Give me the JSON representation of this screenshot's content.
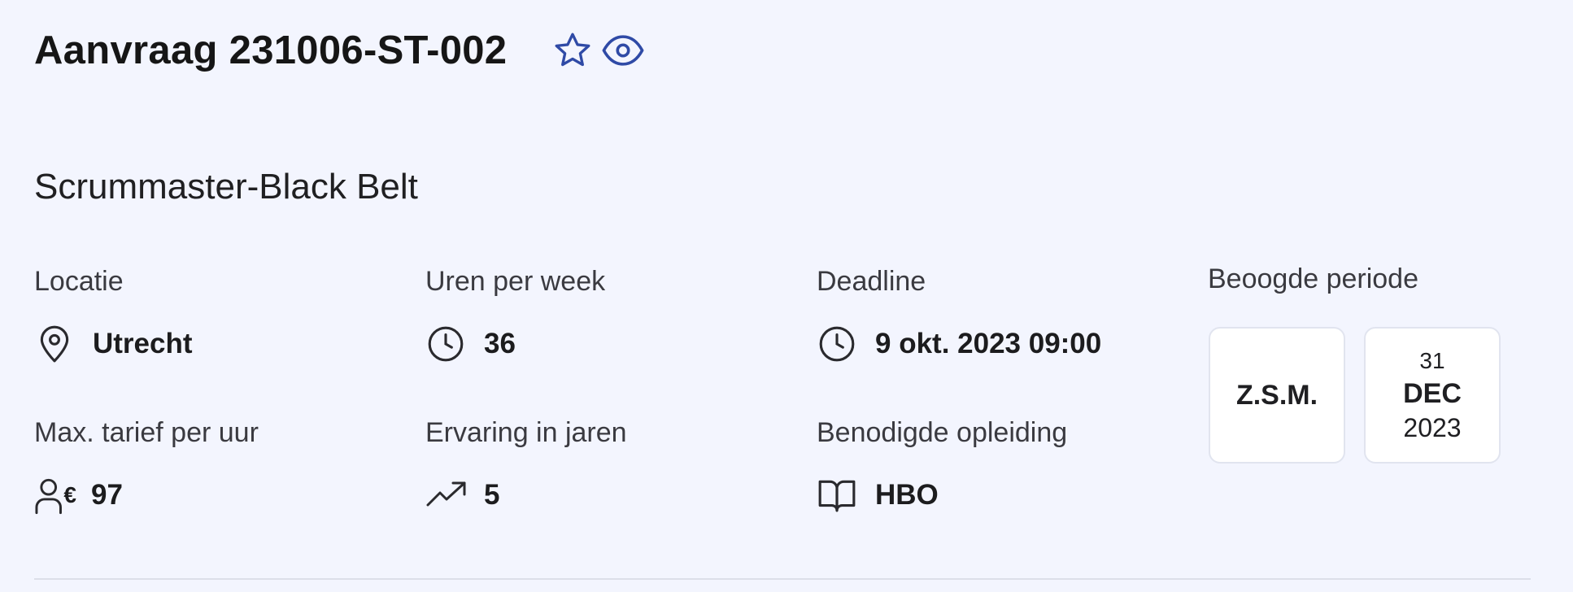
{
  "header": {
    "title": "Aanvraag 231006-ST-002",
    "favorite_icon": "star-icon",
    "watch_icon": "eye-icon"
  },
  "subtitle": "Scrummaster-Black Belt",
  "fields": {
    "location": {
      "label": "Locatie",
      "value": "Utrecht",
      "icon": "map-pin-icon"
    },
    "hours": {
      "label": "Uren per week",
      "value": "36",
      "icon": "clock-icon"
    },
    "deadline": {
      "label": "Deadline",
      "value": "9 okt. 2023 09:00",
      "icon": "clock-icon"
    },
    "rate": {
      "label": "Max. tarief per uur",
      "value": "97",
      "currency": "€",
      "icon": "user-euro-icon"
    },
    "experience": {
      "label": "Ervaring in jaren",
      "value": "5",
      "icon": "trending-up-icon"
    },
    "education": {
      "label": "Benodigde opleiding",
      "value": "HBO",
      "icon": "book-open-icon"
    }
  },
  "period": {
    "label": "Beoogde periode",
    "start": "Z.S.M.",
    "end": {
      "day": "31",
      "month": "DEC",
      "year": "2023"
    }
  },
  "colors": {
    "background": "#f3f5fe",
    "accent": "#2f4aa6",
    "text": "#1c1c1e",
    "card": "#ffffff"
  }
}
